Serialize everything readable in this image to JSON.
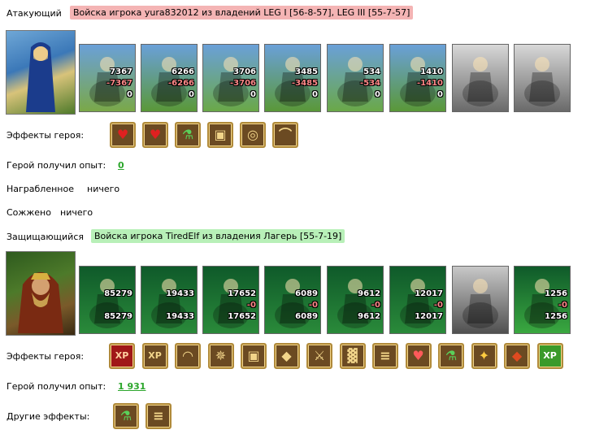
{
  "attacker": {
    "label": "Атакующий",
    "tag": "Войска игрока yura832012 из владений LEG I [56-8-57], LEG III [55-7-57]",
    "units": [
      {
        "top": "7367",
        "mid": "-7367",
        "bot": "0"
      },
      {
        "top": "6266",
        "mid": "-6266",
        "bot": "0"
      },
      {
        "top": "3706",
        "mid": "-3706",
        "bot": "0"
      },
      {
        "top": "3485",
        "mid": "-3485",
        "bot": "0"
      },
      {
        "top": "534",
        "mid": "-534",
        "bot": "0"
      },
      {
        "top": "1410",
        "mid": "-1410",
        "bot": "0"
      },
      {
        "top": "",
        "mid": "",
        "bot": ""
      },
      {
        "top": "",
        "mid": "",
        "bot": ""
      }
    ],
    "effects_label": "Эффекты героя:",
    "effects": [
      "heart-icon",
      "heart-hand-icon",
      "potion-icon",
      "armor-icon",
      "ring-icon",
      "bow-icon"
    ],
    "exp_label": "Герой получил опыт:",
    "exp_value": "0",
    "loot_label": "Награбленное",
    "loot_value": "ничего",
    "burned_label": "Сожжено",
    "burned_value": "ничего"
  },
  "defender": {
    "label": "Защищающийся",
    "tag": "Войска игрока TiredElf из владения Лагерь [55-7-19]",
    "units": [
      {
        "top": "85279",
        "mid": "",
        "bot": "85279"
      },
      {
        "top": "19433",
        "mid": "",
        "bot": "19433"
      },
      {
        "top": "17652",
        "mid": "-0",
        "bot": "17652"
      },
      {
        "top": "6089",
        "mid": "-0",
        "bot": "6089"
      },
      {
        "top": "9612",
        "mid": "-0",
        "bot": "9612"
      },
      {
        "top": "12017",
        "mid": "-0",
        "bot": "12017"
      },
      {
        "top": "",
        "mid": "",
        "bot": ""
      },
      {
        "top": "1256",
        "mid": "-0",
        "bot": "1256"
      }
    ],
    "effects_label": "Эффекты героя:",
    "effects": [
      "xp-icon",
      "scroll-xp-icon",
      "helmet-icon",
      "web-icon",
      "armor-icon",
      "shield-icon",
      "sword-icon",
      "cage-icon",
      "scroll-icon",
      "heart-leaf-icon",
      "potion-icon",
      "gold-icon",
      "shield-red-icon",
      "xp-green-icon"
    ],
    "exp_label": "Герой получил опыт:",
    "exp_value": "1 931",
    "other_label": "Другие эффекты:",
    "other_effects": [
      "potion-icon",
      "scroll-rune-icon"
    ]
  },
  "colors": {
    "attacker_tag": "#f4b4b4",
    "defender_tag": "#b8f0b8",
    "link": "#2ca62c",
    "loss": "#ff8888"
  }
}
